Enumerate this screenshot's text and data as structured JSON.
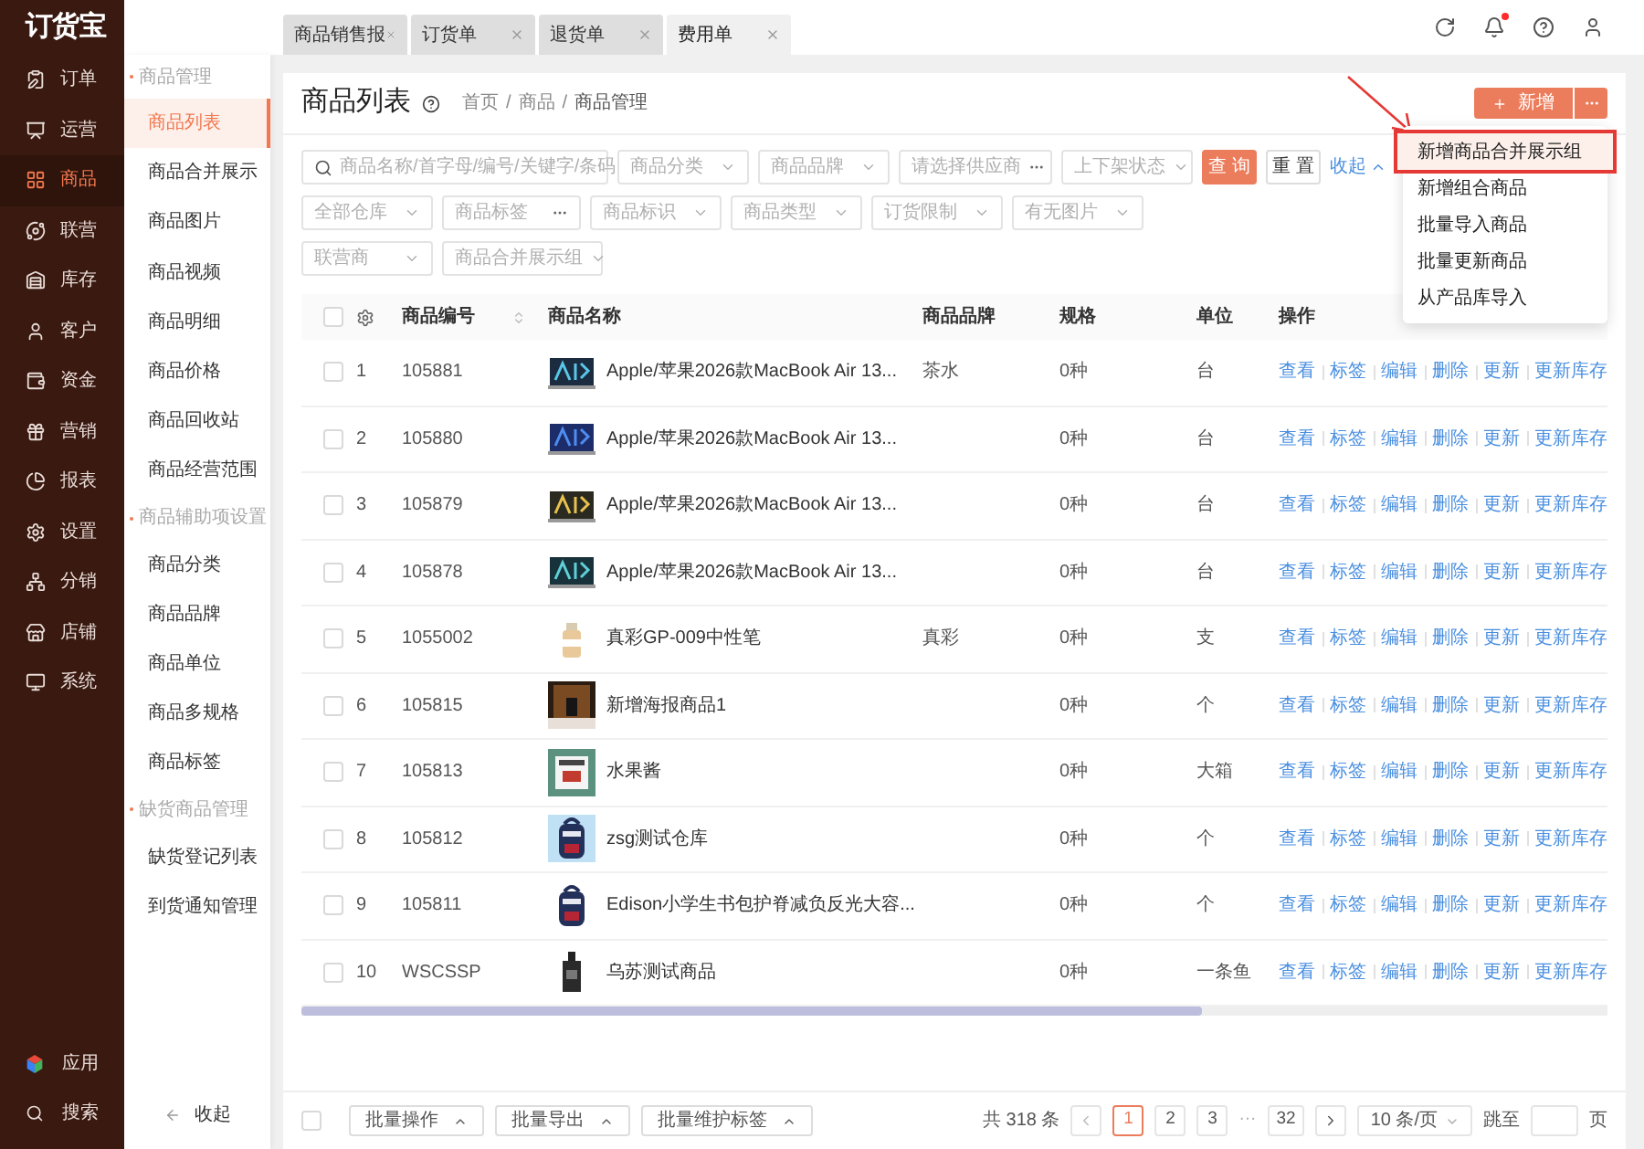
{
  "logo": "订货宝",
  "nav": [
    {
      "label": "订单",
      "selected": false
    },
    {
      "label": "运营",
      "selected": false
    },
    {
      "label": "商品",
      "selected": true
    },
    {
      "label": "联营",
      "selected": false
    },
    {
      "label": "库存",
      "selected": false
    },
    {
      "label": "客户",
      "selected": false
    },
    {
      "label": "资金",
      "selected": false
    },
    {
      "label": "营销",
      "selected": false
    },
    {
      "label": "报表",
      "selected": false
    },
    {
      "label": "设置",
      "selected": false
    },
    {
      "label": "分销",
      "selected": false
    },
    {
      "label": "店铺",
      "selected": false
    },
    {
      "label": "系统",
      "selected": false
    }
  ],
  "nav_bottom": [
    "应用",
    "搜索"
  ],
  "submenu": {
    "groups": [
      {
        "title": "商品管理",
        "items": [
          {
            "label": "商品列表",
            "selected": true
          },
          {
            "label": "商品合并展示",
            "selected": false
          },
          {
            "label": "商品图片",
            "selected": false
          },
          {
            "label": "商品视频",
            "selected": false
          },
          {
            "label": "商品明细",
            "selected": false
          },
          {
            "label": "商品价格",
            "selected": false
          },
          {
            "label": "商品回收站",
            "selected": false
          },
          {
            "label": "商品经营范围",
            "selected": false
          }
        ]
      },
      {
        "title": "商品辅助项设置",
        "items": [
          {
            "label": "商品分类",
            "selected": false
          },
          {
            "label": "商品品牌",
            "selected": false
          },
          {
            "label": "商品单位",
            "selected": false
          },
          {
            "label": "商品多规格",
            "selected": false
          },
          {
            "label": "商品标签",
            "selected": false
          }
        ]
      },
      {
        "title": "缺货商品管理",
        "items": [
          {
            "label": "缺货登记列表",
            "selected": false
          },
          {
            "label": "到货通知管理",
            "selected": false
          }
        ]
      }
    ],
    "collapse": "收起"
  },
  "tabs": [
    {
      "label": "商品销售报",
      "selected": false
    },
    {
      "label": "订货单",
      "selected": false
    },
    {
      "label": "退货单",
      "selected": false
    },
    {
      "label": "费用单",
      "selected": true
    }
  ],
  "notification": true,
  "page": {
    "title": "商品列表",
    "breadcrumb": [
      "首页",
      "商品",
      "商品管理"
    ],
    "breadcrumb_separator": "/",
    "new_button": "新增"
  },
  "menu": [
    {
      "label": "新增商品合并展示组",
      "selected": true,
      "annotated": true
    },
    {
      "label": "新增组合商品",
      "selected": false,
      "annotated": false
    },
    {
      "label": "批量导入商品",
      "selected": false,
      "annotated": false
    },
    {
      "label": "批量更新商品",
      "selected": false,
      "annotated": false
    },
    {
      "label": "从产品库导入",
      "selected": false,
      "annotated": false
    }
  ],
  "filters": [
    [
      {
        "kind": "search",
        "placeholder": "商品名称/首字母/编号/关键字/条码"
      },
      {
        "kind": "select",
        "placeholder": "商品分类"
      },
      {
        "kind": "select",
        "placeholder": "商品品牌"
      },
      {
        "kind": "picker",
        "placeholder": "请选择供应商"
      },
      {
        "kind": "select",
        "placeholder": "上下架状态"
      }
    ],
    [
      {
        "kind": "select",
        "placeholder": "全部仓库"
      },
      {
        "kind": "picker",
        "placeholder": "商品标签"
      },
      {
        "kind": "select",
        "placeholder": "商品标识"
      },
      {
        "kind": "select",
        "placeholder": "商品类型"
      },
      {
        "kind": "select",
        "placeholder": "订货限制"
      },
      {
        "kind": "select",
        "placeholder": "有无图片"
      }
    ],
    [
      {
        "kind": "select",
        "placeholder": "联营商"
      },
      {
        "kind": "select",
        "placeholder": "商品合并展示组"
      }
    ]
  ],
  "query_button": "查 询",
  "reset_button": "重 置",
  "collapse_link": "收起",
  "table": {
    "header_checked": false,
    "columns": [
      "商品编号",
      "商品名称",
      "商品品牌",
      "规格",
      "单位",
      "操作"
    ],
    "rows": [
      {
        "checked": false,
        "index": "1",
        "code": "105881",
        "name": "Apple/苹果2026款MacBook Air 13...",
        "brand": "茶水",
        "spec": "0种",
        "unit": "台",
        "actions": [
          "查看",
          "标签",
          "编辑",
          "删除",
          "更新",
          "更新库存"
        ]
      },
      {
        "checked": false,
        "index": "2",
        "code": "105880",
        "name": "Apple/苹果2026款MacBook Air 13...",
        "brand": "",
        "spec": "0种",
        "unit": "台",
        "actions": [
          "查看",
          "标签",
          "编辑",
          "删除",
          "更新",
          "更新库存"
        ]
      },
      {
        "checked": false,
        "index": "3",
        "code": "105879",
        "name": "Apple/苹果2026款MacBook Air 13...",
        "brand": "",
        "spec": "0种",
        "unit": "台",
        "actions": [
          "查看",
          "标签",
          "编辑",
          "删除",
          "更新",
          "更新库存"
        ]
      },
      {
        "checked": false,
        "index": "4",
        "code": "105878",
        "name": "Apple/苹果2026款MacBook Air 13...",
        "brand": "",
        "spec": "0种",
        "unit": "台",
        "actions": [
          "查看",
          "标签",
          "编辑",
          "删除",
          "更新",
          "更新库存"
        ]
      },
      {
        "checked": false,
        "index": "5",
        "code": "1055002",
        "name": "真彩GP-009中性笔",
        "brand": "真彩",
        "spec": "0种",
        "unit": "支",
        "actions": [
          "查看",
          "标签",
          "编辑",
          "删除",
          "更新",
          "更新库存"
        ]
      },
      {
        "checked": false,
        "index": "6",
        "code": "105815",
        "name": "新增海报商品1",
        "brand": "",
        "spec": "0种",
        "unit": "个",
        "actions": [
          "查看",
          "标签",
          "编辑",
          "删除",
          "更新",
          "更新库存"
        ]
      },
      {
        "checked": false,
        "index": "7",
        "code": "105813",
        "name": "水果酱",
        "brand": "",
        "spec": "0种",
        "unit": "大箱",
        "actions": [
          "查看",
          "标签",
          "编辑",
          "删除",
          "更新",
          "更新库存"
        ]
      },
      {
        "checked": false,
        "index": "8",
        "code": "105812",
        "name": "zsg测试仓库",
        "brand": "",
        "spec": "0种",
        "unit": "个",
        "actions": [
          "查看",
          "标签",
          "编辑",
          "删除",
          "更新",
          "更新库存"
        ]
      },
      {
        "checked": false,
        "index": "9",
        "code": "105811",
        "name": "Edison小学生书包护脊减负反光大容...",
        "brand": "",
        "spec": "0种",
        "unit": "个",
        "actions": [
          "查看",
          "标签",
          "编辑",
          "删除",
          "更新",
          "更新库存"
        ]
      },
      {
        "checked": false,
        "index": "10",
        "code": "WSCSSP",
        "name": "乌苏测试商品",
        "brand": "",
        "spec": "0种",
        "unit": "一条鱼",
        "actions": [
          "查看",
          "标签",
          "编辑",
          "删除",
          "更新",
          "更新库存"
        ]
      }
    ]
  },
  "footer": {
    "all_checked": false,
    "batch_buttons": [
      "批量操作",
      "批量导出",
      "批量维护标签"
    ],
    "total": "共 318 条",
    "pages": [
      {
        "label": "1",
        "selected": true
      },
      {
        "label": "2",
        "selected": false
      },
      {
        "label": "3",
        "selected": false
      }
    ],
    "ellipsis": "···",
    "last_page": {
      "label": "32",
      "selected": false
    },
    "page_size": "10 条/页",
    "jump_label": "跳至",
    "page_unit": "页"
  }
}
